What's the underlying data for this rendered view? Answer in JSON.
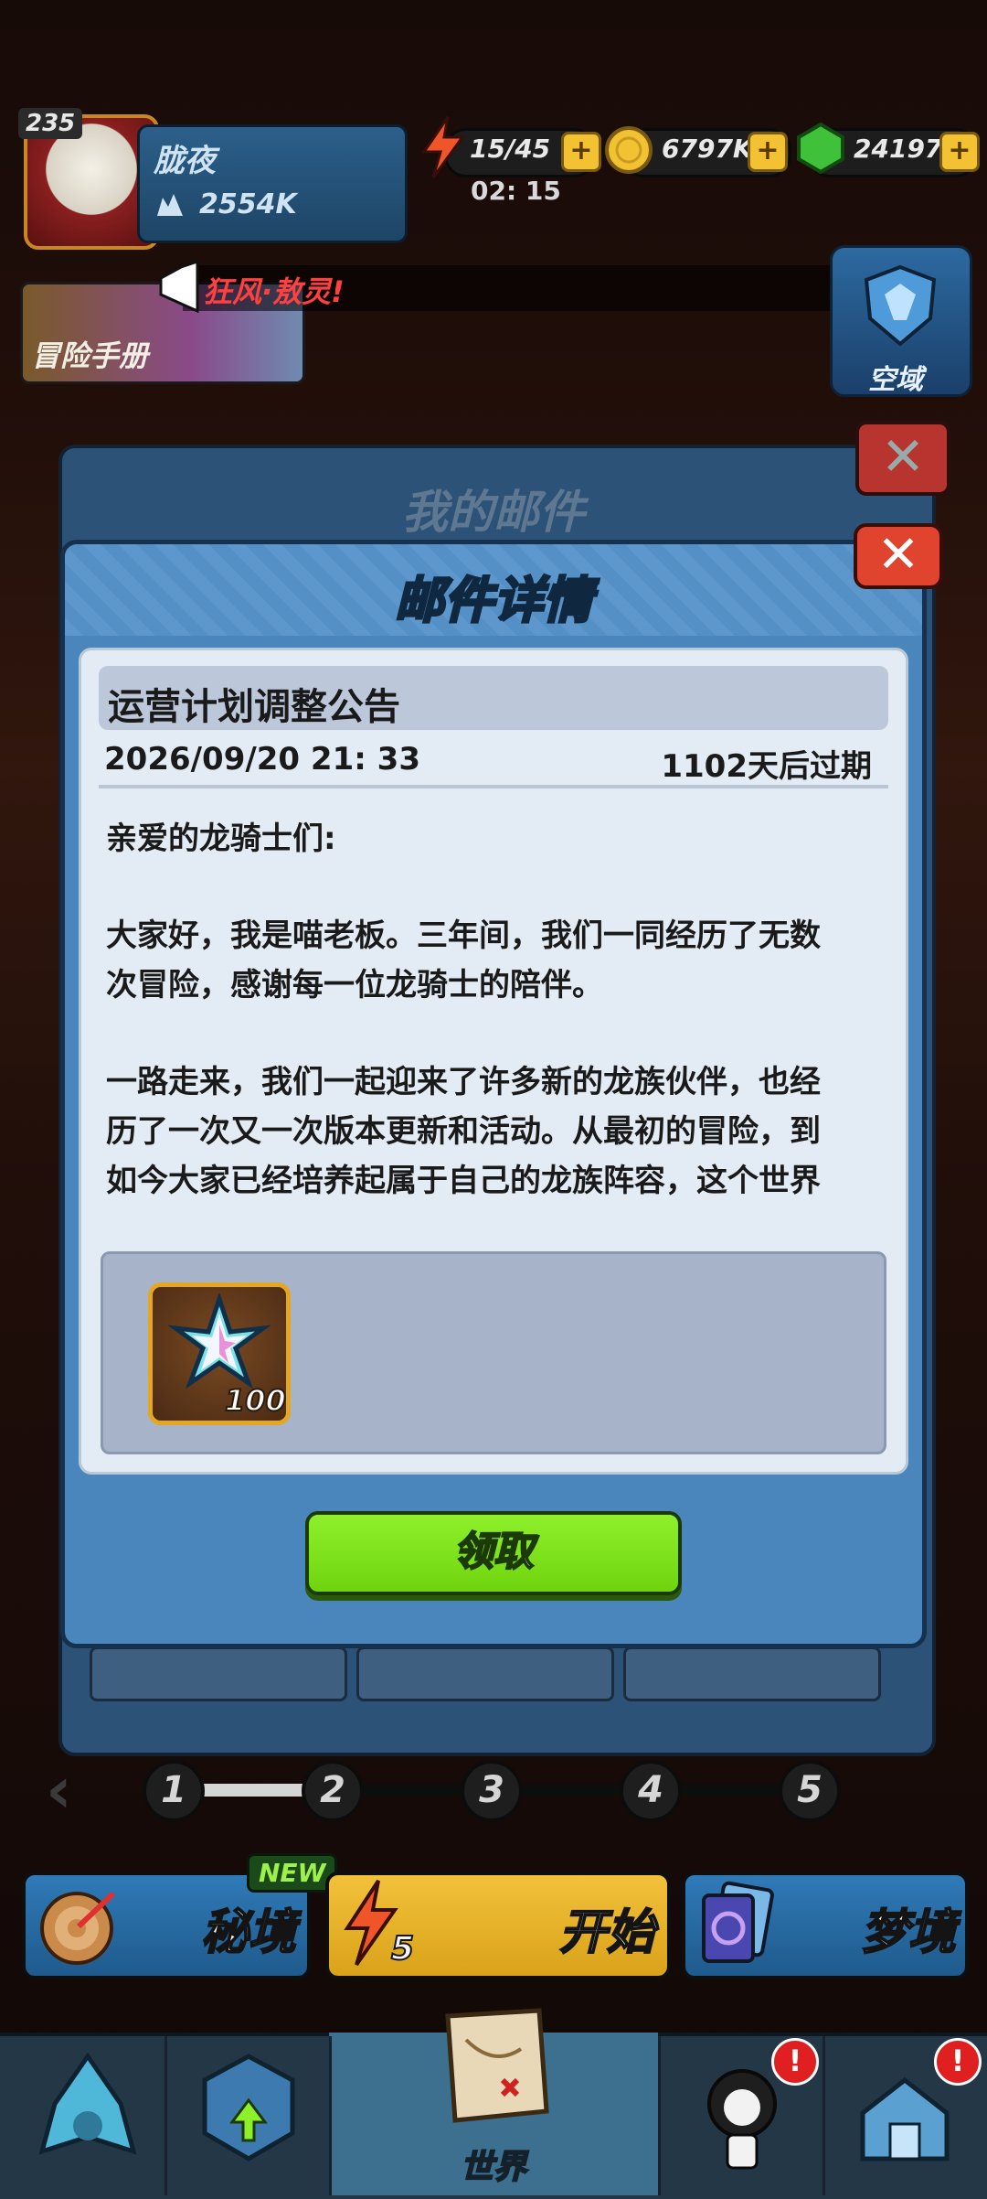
{
  "hud": {
    "level": "235",
    "player_name": "胧夜",
    "power": "2554K",
    "energy": "15/45",
    "energy_timer": "02: 15",
    "gold": "6797K",
    "gems": "24197",
    "plus": "+"
  },
  "notice": {
    "text": "狂风·敖灵!"
  },
  "side": {
    "manual_label": "冒险手册",
    "airspace_label": "空域"
  },
  "back_panel": {
    "title": "我的邮件",
    "close": "✕"
  },
  "dialog": {
    "title": "邮件详情",
    "close": "✕",
    "mail_title": "运营计划调整公告",
    "date": "2026/09/20 21: 33",
    "expire": "1102天后过期",
    "body": {
      "greeting": "亲爱的龙骑士们:",
      "p1_line1": "大家好，我是喵老板。三年间，我们一同经历了无数",
      "p1_line2": "次冒险，感谢每一位龙骑士的陪伴。",
      "p2_line1": "一路走来，我们一起迎来了许多新的龙族伙伴，也经",
      "p2_line2": "历了一次又一次版本更新和活动。从最初的冒险，到",
      "p2_line3": "如今大家已经培养起属于自己的龙族阵容，这个世界"
    },
    "reward": {
      "icon": "crystal-star-icon",
      "count": "100"
    },
    "claim_label": "领取"
  },
  "pagination": {
    "pages": [
      "1",
      "2",
      "3",
      "4",
      "5"
    ],
    "current": "1"
  },
  "modes": {
    "secret_label": "秘境",
    "new_badge": "NEW",
    "start_label": "开始",
    "start_cost": "5",
    "dream_label": "梦境"
  },
  "nav": {
    "items": [
      "dragon-icon",
      "dice-upgrade-icon",
      "world-map-icon",
      "character-icon",
      "building-icon"
    ],
    "world_label": "世界",
    "alert": "!"
  },
  "colors": {
    "accent_blue": "#4a86bc",
    "claim_green": "#7be01c",
    "close_red": "#e0442f"
  }
}
